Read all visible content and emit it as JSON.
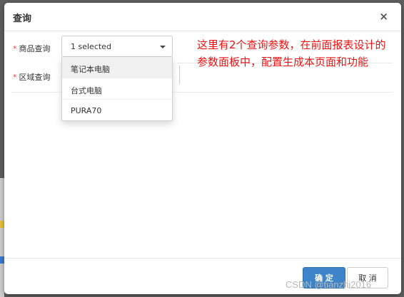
{
  "dialog": {
    "title": "查询",
    "close_symbol": "×"
  },
  "fields": [
    {
      "required_mark": "*",
      "label": "商品查询"
    },
    {
      "required_mark": "*",
      "label": "区域查询"
    }
  ],
  "product_select": {
    "value": "1 selected",
    "options": [
      {
        "label": "笔记本电脑",
        "highlighted": true
      },
      {
        "label": "台式电脑",
        "highlighted": false
      },
      {
        "label": "PURA70",
        "highlighted": false
      }
    ]
  },
  "annotation": {
    "text": "这里有2个查询参数，在前面报表设计的参数面板中，配置生成本页面和功能",
    "color": "#ee1111"
  },
  "footer": {
    "ok_label": "确 定",
    "cancel_label": "取 消",
    "ok_color": "#3d84c8"
  },
  "watermark": "CSDN @tianzhi2016"
}
